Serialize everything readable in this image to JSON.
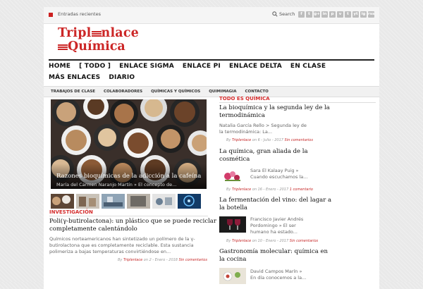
{
  "topbar": {
    "recent_label": "Entradas recientes",
    "search_label": "Search",
    "social_icons": [
      "f",
      "t",
      "g+",
      "in",
      "p",
      "v",
      "t",
      "yt",
      "ig",
      "rss"
    ]
  },
  "logo": {
    "line1": "Tripl",
    "line1b": "nlace",
    "line2": "Química"
  },
  "mainnav": {
    "row1": [
      "HOME",
      "[ TODO ]",
      "ENLACE SIGMA",
      "ENLACE PI",
      "ENLACE DELTA",
      "EN CLASE"
    ],
    "row2": [
      "MÁS ENLACES",
      "DIARIO"
    ]
  },
  "subnav": [
    "TRABAJOS DE CLASE",
    "COLABORADORES",
    "QUÍMICAS Y QUÍMICOS",
    "QUIMIMAGIA",
    "CONTACTO"
  ],
  "feature": {
    "title": "Razones bioquímicas de la adicción a la cafeína",
    "meta": "María del Carmen Naranjo Martín » El concepto de..."
  },
  "investigacion": {
    "section": "INVESTIGACIÓN",
    "title_l1": "Poli(γ-butirolactona): un plástico que se puede reciclar",
    "title_l2": "completamente calentándolo",
    "body_l1": "Químicos norteamericanos han sintetizado un polímero de la γ-",
    "body_l2": "butirolactona que es completamente reciclable. Esta sustancia",
    "body_l3": "polimeriza a bajas temperaturas convirtiéndose en...",
    "meta_by": "By",
    "meta_author": "Triplenlace",
    "meta_date": "on 2 - Enero - 2018",
    "meta_comments": "Sin comentarios"
  },
  "todo": {
    "section": "TODO ES QUÍMICA",
    "posts": [
      {
        "title_l1": "La bioquímica y la segunda ley de la",
        "title_l2": "termodinámica",
        "body_l1": "Natalia García Rello > Segunda ley de",
        "body_l2": "la termodinámica: La...",
        "by": "By",
        "author": "Triplenlace",
        "date": "on 6 - Julio - 2017",
        "comments": "Sin comentarios"
      },
      {
        "title_l1": "La química, gran aliada de la",
        "title_l2": "cosmética",
        "body_l1": "Sara El Kalaay Puig »",
        "body_l2": "Cuando escuchamos la...",
        "by": "By",
        "author": "Triplenlace",
        "date": "on 16 - Enero - 2017",
        "comments": "1 comentario"
      },
      {
        "title_l1": "La fermentación del vino: del lagar a",
        "title_l2": "la botella",
        "body_l1": "Francisco Javier Andrés",
        "body_l2": "Pordomingo » El ser",
        "body_l3": "humano ha estado...",
        "by": "By",
        "author": "Triplenlace",
        "date": "on 10 - Enero - 2017",
        "comments": "Sin comentarios"
      },
      {
        "title_l1": "Gastronomía molecular: química en",
        "title_l2": "la cocina",
        "body_l1": "David Campos Marín »",
        "body_l2": "En día conocemos a la..."
      }
    ]
  },
  "colors": {
    "accent": "#cc2727",
    "nav_text": "#111111",
    "topbar": "#f5f5f5"
  }
}
